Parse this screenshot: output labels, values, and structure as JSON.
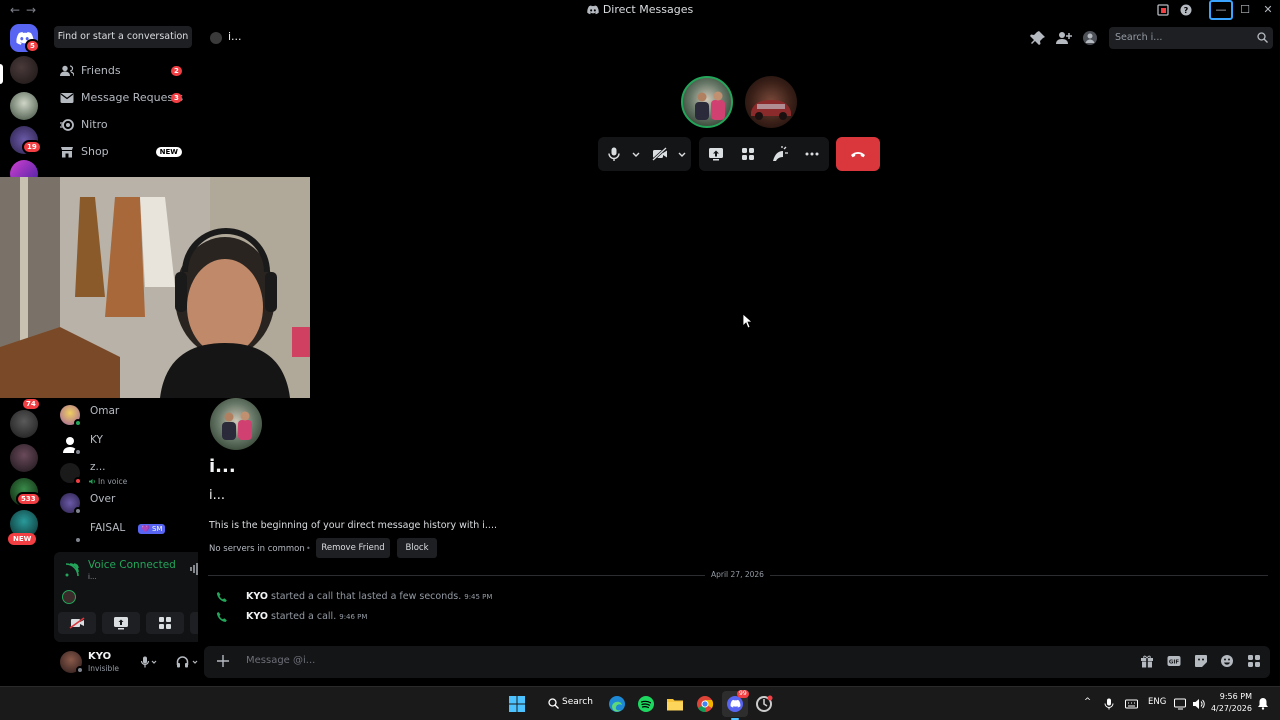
{
  "window": {
    "title": "Direct Messages",
    "back": "←",
    "forward": "→",
    "minimize": "—",
    "maximize": "☐",
    "close": "✕"
  },
  "rail": {
    "badges": [
      "5",
      "19",
      "74",
      "533"
    ],
    "new_label": "NEW"
  },
  "sidebar": {
    "find_label": "Find or start a conversation",
    "nav": [
      {
        "label": "Friends",
        "count": "2",
        "icon": "friends-icon"
      },
      {
        "label": "Message Requests",
        "count": "3",
        "icon": "mail-icon"
      },
      {
        "label": "Nitro",
        "count": "",
        "icon": "nitro-icon"
      },
      {
        "label": "Shop",
        "badge": "NEW",
        "icon": "shop-icon"
      }
    ],
    "dms": [
      {
        "name": "Omar",
        "sub": ""
      },
      {
        "name": "KY",
        "sub": ""
      },
      {
        "name": "z...",
        "sub": "In voice"
      },
      {
        "name": "Over",
        "sub": ""
      },
      {
        "name": "FAISAL",
        "tag": "💜 SM",
        "sub": ""
      }
    ]
  },
  "voice": {
    "title": "Voice Connected",
    "sub": "i..."
  },
  "user": {
    "name": "KYO",
    "status": "Invisible"
  },
  "header": {
    "name": "i...",
    "search_placeholder": "Search i..."
  },
  "chat": {
    "title": "i...",
    "subtitle": "i...",
    "description": "This is the beginning of your direct message history with i....",
    "no_servers": "No servers in common",
    "remove_friend": "Remove Friend",
    "block": "Block",
    "date": "April 27, 2026",
    "messages": [
      {
        "user": "KYO",
        "text": "started a call that lasted a few seconds.",
        "time": "9:45 PM"
      },
      {
        "user": "KYO",
        "text": "started a call.",
        "time": "9:46 PM"
      }
    ],
    "input_placeholder": "Message @i..."
  },
  "taskbar": {
    "search_label": "Search",
    "lang": "ENG",
    "time": "9:56 PM",
    "date": "4/27/2026"
  },
  "colors": {
    "accent": "#5865f2",
    "danger": "#da373c",
    "online": "#23a55a"
  }
}
